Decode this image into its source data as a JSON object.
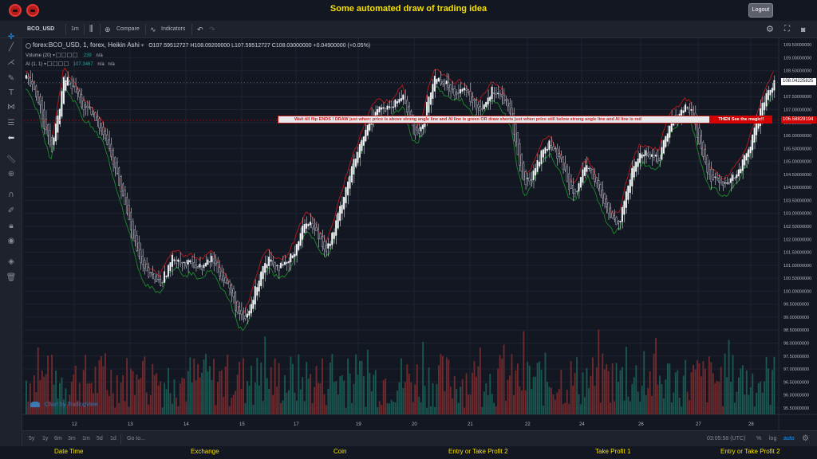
{
  "app": {
    "title": "Some automated draw of trading idea",
    "logout_label": "Logout"
  },
  "toolbar": {
    "symbol": "BCO_USD",
    "interval": "1m",
    "compare_label": "Compare",
    "indicators_label": "Indicators"
  },
  "legend": {
    "symbol_line": "forex:BCO_USD, 1, forex, Heikin Ashi",
    "ohlc": "O107.59512727  H108.09200000  L107.59512727  C108.03000000  +0.04900000 (+0.05%)",
    "volume_label": "Volume (20)",
    "volume_value": "239",
    "volume_na": "n/a",
    "ai_label": "AI (1, 1)",
    "ai_value": "107.3467",
    "ai_na1": "n/a",
    "ai_na2": "n/a"
  },
  "watermark": "Chart by TradingView",
  "banner": {
    "text": "Wait till flip ENDS  !  DRAW just when: price is above strong angle line and AI line is green        OR        draw shorts just when price still below strong angle line and AI line is red",
    "magic": "THEN See the magic!!"
  },
  "price_axis": {
    "labels": [
      "109.50000000",
      "109.00000000",
      "108.50000000",
      "108.00000000",
      "107.50000000",
      "107.00000000",
      "106.50000000",
      "106.00000000",
      "105.50000000",
      "105.00000000",
      "104.50000000",
      "104.00000000",
      "103.50000000",
      "103.00000000",
      "102.50000000",
      "102.00000000",
      "101.50000000",
      "101.00000000",
      "100.50000000",
      "100.00000000",
      "99.50000000",
      "99.00000000",
      "98.50000000",
      "98.00000000",
      "97.50000000",
      "97.00000000",
      "96.50000000",
      "96.00000000",
      "95.50000000"
    ],
    "current_price": "108.04225825",
    "alert_price": "106.58829194"
  },
  "time_axis": {
    "labels": [
      "12",
      "13",
      "14",
      "15",
      "17",
      "19",
      "20",
      "21",
      "22",
      "24",
      "26",
      "27",
      "28"
    ]
  },
  "bottombar": {
    "ranges": [
      "5y",
      "1y",
      "6m",
      "3m",
      "1m",
      "5d",
      "1d"
    ],
    "goto": "Go to...",
    "clock": "03:05:58 (UTC)",
    "percent": "%",
    "log": "log",
    "auto": "auto"
  },
  "footer": {
    "items": [
      "Date Time",
      "Exchange",
      "Coin",
      "Entry or Take Profit 2",
      "Take Profit 1",
      "Entry or Take Profit 2"
    ]
  },
  "colors": {
    "up": "#26a69a",
    "down": "#ef5350",
    "ai_green": "#1b8a2a",
    "ai_red": "#b71c1c",
    "title": "#f5e000"
  },
  "chart_data": {
    "type": "candlestick",
    "close_path": [
      108.2,
      107.8,
      107.3,
      106.2,
      105.4,
      106.8,
      108.3,
      107.9,
      107.6,
      107.0,
      106.9,
      106.5,
      106.2,
      105.4,
      104.6,
      103.7,
      102.9,
      101.8,
      101.0,
      100.6,
      100.5,
      100.3,
      100.8,
      101.3,
      101.2,
      101.0,
      101.1,
      100.9,
      101.0,
      101.3,
      100.8,
      100.4,
      100.0,
      99.2,
      98.8,
      99.3,
      100.2,
      101.0,
      101.3,
      101.0,
      100.9,
      101.1,
      101.6,
      102.3,
      102.8,
      102.4,
      102.0,
      101.6,
      102.2,
      103.1,
      104.0,
      104.8,
      105.4,
      106.1,
      106.8,
      107.1,
      107.0,
      107.0,
      107.3,
      107.6,
      106.6,
      106.0,
      106.4,
      107.5,
      108.3,
      108.1,
      107.9,
      107.7,
      107.8,
      107.6,
      107.2,
      107.0,
      107.4,
      107.8,
      107.6,
      107.2,
      106.6,
      105.0,
      104.1,
      104.4,
      105.0,
      105.5,
      105.7,
      105.2,
      104.8,
      104.0,
      103.9,
      104.5,
      104.8,
      104.2,
      103.6,
      103.0,
      102.7,
      102.8,
      104.0,
      104.8,
      105.3,
      105.3,
      105.2,
      105.1,
      106.0,
      106.6,
      106.8,
      107.1,
      107.0,
      106.0,
      105.0,
      104.4,
      104.3,
      104.0,
      104.2,
      104.5,
      104.9,
      105.4,
      106.2,
      107.0,
      107.6,
      108.1
    ]
  }
}
